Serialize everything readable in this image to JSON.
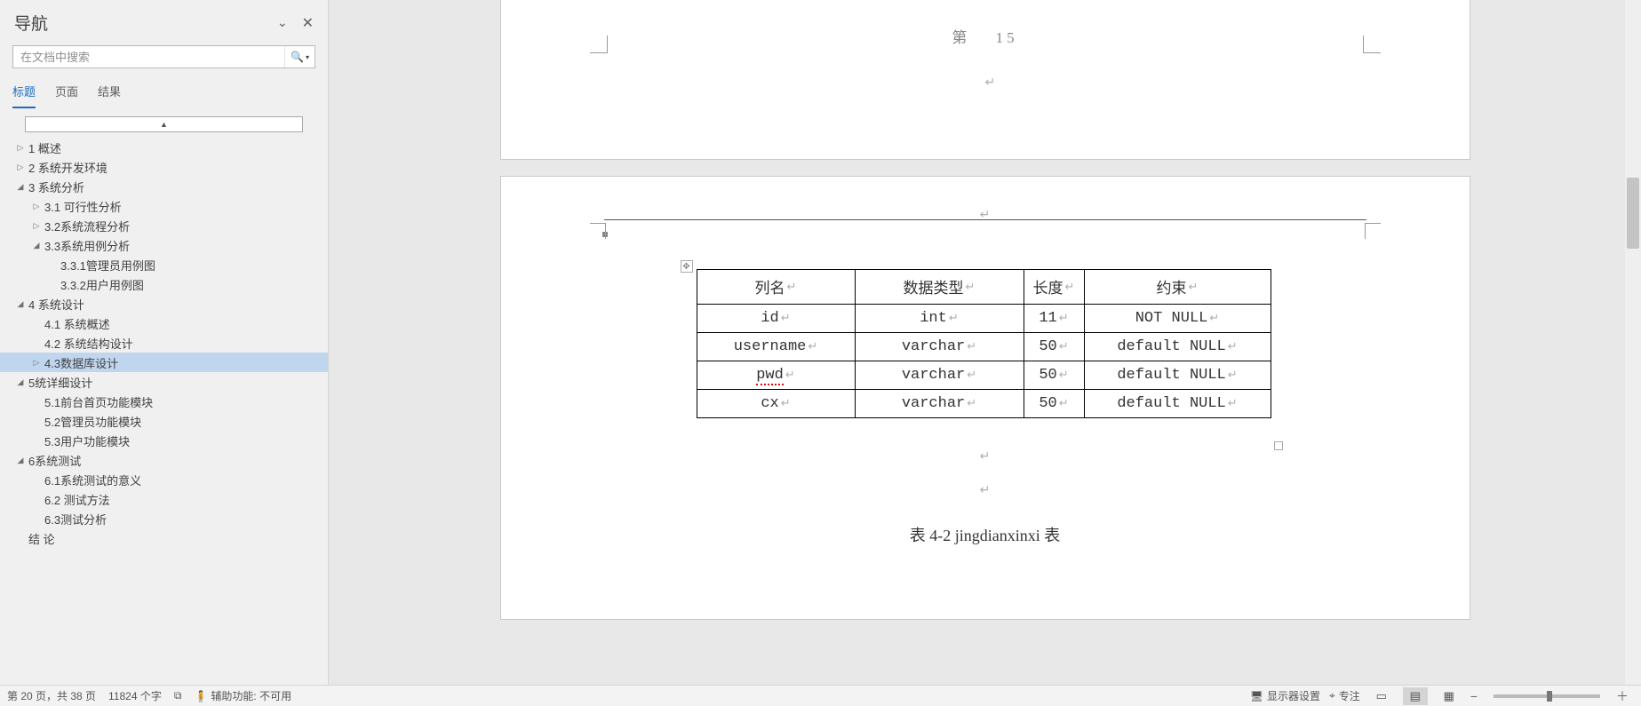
{
  "nav": {
    "title": "导航",
    "search_placeholder": "在文档中搜索",
    "tabs": {
      "headings": "标题",
      "pages": "页面",
      "results": "结果"
    }
  },
  "outline": [
    {
      "indent": 0,
      "caret": "▷",
      "label": "1 概述"
    },
    {
      "indent": 0,
      "caret": "▷",
      "label": "2 系统开发环境"
    },
    {
      "indent": 0,
      "caret": "◢",
      "label": "3 系统分析"
    },
    {
      "indent": 1,
      "caret": "▷",
      "label": "3.1 可行性分析"
    },
    {
      "indent": 1,
      "caret": "▷",
      "label": "3.2系统流程分析"
    },
    {
      "indent": 1,
      "caret": "◢",
      "label": "3.3系统用例分析"
    },
    {
      "indent": 2,
      "caret": "",
      "label": "3.3.1管理员用例图"
    },
    {
      "indent": 2,
      "caret": "",
      "label": "3.3.2用户用例图"
    },
    {
      "indent": 0,
      "caret": "◢",
      "label": "4 系统设计"
    },
    {
      "indent": 1,
      "caret": "",
      "label": "4.1 系统概述"
    },
    {
      "indent": 1,
      "caret": "",
      "label": "4.2 系统结构设计"
    },
    {
      "indent": 1,
      "caret": "▷",
      "label": "4.3数据库设计",
      "selected": true
    },
    {
      "indent": 0,
      "caret": "◢",
      "label": "5统详细设计"
    },
    {
      "indent": 1,
      "caret": "",
      "label": "5.1前台首页功能模块"
    },
    {
      "indent": 1,
      "caret": "",
      "label": "5.2管理员功能模块"
    },
    {
      "indent": 1,
      "caret": "",
      "label": "5.3用户功能模块"
    },
    {
      "indent": 0,
      "caret": "◢",
      "label": "6系统测试"
    },
    {
      "indent": 1,
      "caret": "",
      "label": "6.1系统测试的意义"
    },
    {
      "indent": 1,
      "caret": "",
      "label": "6.2 测试方法"
    },
    {
      "indent": 1,
      "caret": "",
      "label": "6.3测试分析"
    },
    {
      "indent": 0,
      "caret": "",
      "label": "结    论"
    }
  ],
  "doc": {
    "header_word": "第",
    "header_num": "15",
    "table_headers": [
      "列名",
      "数据类型",
      "长度",
      "约束"
    ],
    "table_rows": [
      [
        "id",
        "int",
        "11",
        "NOT NULL"
      ],
      [
        "username",
        "varchar",
        "50",
        "default NULL"
      ],
      [
        "pwd",
        "varchar",
        "50",
        "default NULL"
      ],
      [
        "cx",
        "varchar",
        "50",
        "default NULL"
      ]
    ],
    "caption": "表 4-2  jingdianxinxi 表"
  },
  "status": {
    "page_info": "第 20 页，共 38 页",
    "word_count": "11824 个字",
    "accessibility": "辅助功能: 不可用",
    "display_settings": "显示器设置",
    "focus": "专注"
  }
}
